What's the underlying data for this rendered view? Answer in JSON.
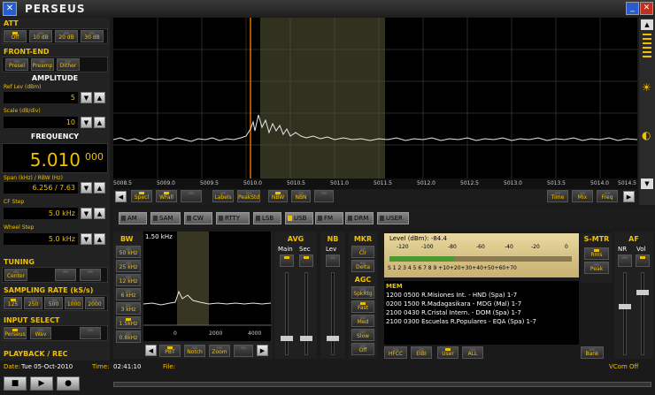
{
  "app": {
    "title": "PERSEUS",
    "icon": "x-logo-icon"
  },
  "att": {
    "title": "ATT",
    "buttons": [
      "Off",
      "10 dB",
      "20 dB",
      "30 dB"
    ],
    "active": 0
  },
  "frontend": {
    "title": "FRONT-END",
    "buttons": [
      "Presel",
      "Preamp",
      "Dither"
    ]
  },
  "amplitude": {
    "title": "AMPLITUDE",
    "ref_label": "Ref Lev (dBm)",
    "ref_value": "5",
    "scale_label": "Scale (dB/div)",
    "scale_value": "10"
  },
  "frequency": {
    "title": "FREQUENCY",
    "main": "5.010",
    "small": "000",
    "span_label": "Span (kHz) / RBW (Hz)",
    "span_value": "6.256 / 7.63",
    "cfstep_label": "CF Step",
    "cfstep_value": "5.0 kHz",
    "wheel_label": "Wheel Step",
    "wheel_value": "5.0 kHz"
  },
  "tuning": {
    "title": "TUNING",
    "buttons": [
      "Center",
      "",
      ""
    ]
  },
  "sampling": {
    "title": "SAMPLING RATE (kS/s)",
    "buttons": [
      "125",
      "250",
      "500",
      "1000",
      "2000"
    ]
  },
  "input": {
    "title": "INPUT SELECT",
    "buttons": [
      "Perseus",
      "Wav",
      ""
    ]
  },
  "playback": {
    "title": "PLAYBACK / REC"
  },
  "axis": {
    "ticks": [
      "5008.5",
      "5009.0",
      "5009.5",
      "5010.0",
      "5010.5",
      "5011.0",
      "5011.5",
      "5012.0",
      "5012.5",
      "5013.0",
      "5013.5",
      "5014.0",
      "5014.5"
    ]
  },
  "spec_toolbar": {
    "buttons": [
      "Specl",
      "WFall",
      "",
      "Labels",
      "PeakStd",
      "NBW",
      "NBN",
      "",
      "Time",
      "Mix",
      "Freq"
    ]
  },
  "modes": {
    "buttons": [
      "AM",
      "SAM",
      "CW",
      "RTTY",
      "LSB",
      "USB",
      "FM",
      "DRM",
      "USER"
    ],
    "active": 5
  },
  "bw": {
    "title": "BW",
    "value": "1.50 kHz",
    "buttons": [
      "50 kHz",
      "25 kHz",
      "12 kHz",
      "6 kHz",
      "3 kHz",
      "1.5kHz",
      "0.8kHz"
    ],
    "ticks": [
      "0",
      "2000",
      "4000"
    ],
    "bottom": [
      "PBT",
      "Notch",
      "Zoom",
      ""
    ]
  },
  "avg": {
    "title": "AVG",
    "main": "Main",
    "sec": "Sec"
  },
  "nb": {
    "title": "NB",
    "lev": "Lev"
  },
  "mkr": {
    "title": "MKR",
    "buttons": [
      "Clr",
      "Delta"
    ]
  },
  "agc": {
    "title": "AGC",
    "buttons": [
      "SpkRtg",
      "Fast",
      "Med",
      "Slow",
      "Off"
    ]
  },
  "smeter": {
    "title": "S-MTR",
    "level": "Level (dBm): -84.4",
    "dbm_scale": [
      "-120",
      "-100",
      "-80",
      "-60",
      "-40",
      "-20",
      "0"
    ],
    "s_scale": "S 1 2 3 4 5 6 7 8 9 +10+20+30+40+50+60+70",
    "buttons": [
      "Rms",
      "Peak"
    ],
    "level_fraction": 0.36
  },
  "af": {
    "title": "AF",
    "nr": "NR",
    "vol": "Vol"
  },
  "mem": {
    "title": "MEM",
    "lines": [
      "1200 0500 R.Misiones Int.  - HND (Spa)  1-7",
      "0200 1500 R.Madagasikara  - MDG (Mal)  1-7",
      "2100 0430 R.Cristal Intern.  - DOM (Spa)  1-7",
      "2100 0300 Escuelas R.Populares  - EQA (Spa)  1-7"
    ],
    "buttons": [
      "HFCC",
      "EIBI",
      "User",
      "ALL",
      "Bank"
    ]
  },
  "status": {
    "date_label": "Date:",
    "date_value": "Tue 05-Oct-2010",
    "time_label": "Time:",
    "time_value": "02:41:10",
    "file_label": "File:",
    "vcom": "VCom Off"
  }
}
